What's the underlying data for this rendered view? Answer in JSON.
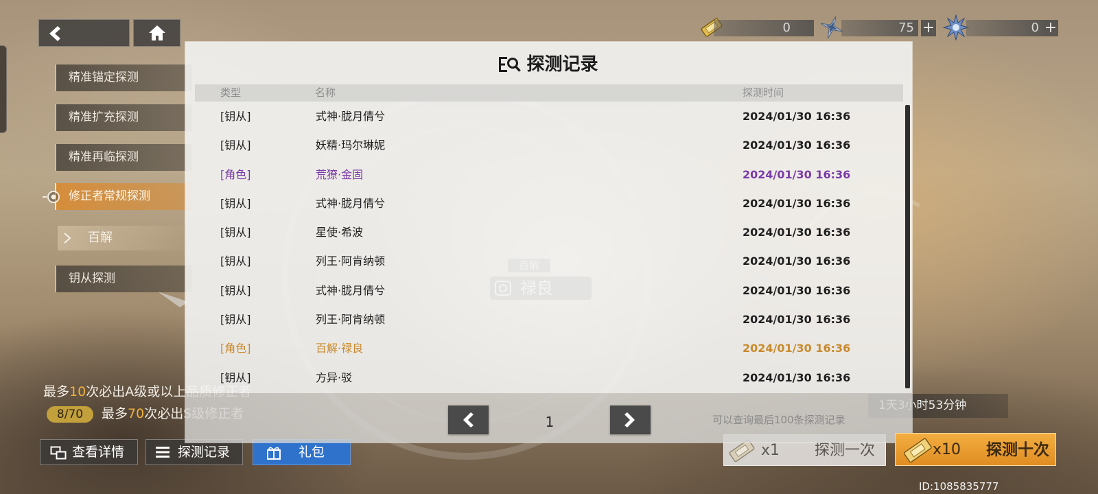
{
  "nav": {
    "back_icon": "arrow-left-icon",
    "home_icon": "home-icon"
  },
  "currencies": [
    {
      "icon": "ticket-icon",
      "value": "0"
    },
    {
      "icon": "star-shard-icon",
      "value": "75",
      "plus_label": "+"
    },
    {
      "icon": "crystal-icon",
      "value": "0",
      "plus_label": "+"
    }
  ],
  "side_menu": {
    "items": [
      {
        "label": "精准锚定探测"
      },
      {
        "label": "精准扩充探测"
      },
      {
        "label": "精准再临探测"
      },
      {
        "label": "修正者常规探测",
        "active": true
      },
      {
        "label": "钥从探测"
      }
    ],
    "sub_item": {
      "label": "百解",
      "icon": "chevron-right-icon",
      "selected": true
    }
  },
  "guarantee": {
    "line1": {
      "prefix": "最多",
      "count": "10",
      "suffix": "次必出A级或以上品质修正者"
    },
    "line2": {
      "progress": "8/70",
      "prefix": "最多",
      "count": "70",
      "suffix": "次必出S级修正者"
    }
  },
  "actions": {
    "details": {
      "label": "查看详情",
      "icon": "windows-icon"
    },
    "records": {
      "label": "探测记录",
      "icon": "list-icon"
    },
    "gift": {
      "label": "礼包",
      "icon": "gift-icon"
    }
  },
  "banner": {
    "tag": "百解",
    "name": "禄良"
  },
  "draw": {
    "timer": "1天3小时53分钟",
    "single": {
      "multiplier": "x1",
      "label": "探测一次",
      "icon": "ticket-icon"
    },
    "ten": {
      "multiplier": "x10",
      "label": "探测十次",
      "icon": "ticket-icon"
    }
  },
  "user_id": "ID:1085835777",
  "modal": {
    "title": "探测记录",
    "title_icon": "list-search-icon",
    "columns": {
      "type": "类型",
      "name": "名称",
      "time": "探测时间"
    },
    "rows": [
      {
        "type": "[钥从]",
        "name": "式神·胧月倩兮",
        "time": "2024/01/30 16:36",
        "tone": "default"
      },
      {
        "type": "[钥从]",
        "name": "妖精·玛尔琳妮",
        "time": "2024/01/30 16:36",
        "tone": "default"
      },
      {
        "type": "[角色]",
        "name": "荒獠·金固",
        "time": "2024/01/30 16:36",
        "tone": "purple"
      },
      {
        "type": "[钥从]",
        "name": "式神·胧月倩兮",
        "time": "2024/01/30 16:36",
        "tone": "default"
      },
      {
        "type": "[钥从]",
        "name": "星使·希波",
        "time": "2024/01/30 16:36",
        "tone": "default"
      },
      {
        "type": "[钥从]",
        "name": "列王·阿肯纳顿",
        "time": "2024/01/30 16:36",
        "tone": "default"
      },
      {
        "type": "[钥从]",
        "name": "式神·胧月倩兮",
        "time": "2024/01/30 16:36",
        "tone": "default"
      },
      {
        "type": "[钥从]",
        "name": "列王·阿肯纳顿",
        "time": "2024/01/30 16:36",
        "tone": "default"
      },
      {
        "type": "[角色]",
        "name": "百解·禄良",
        "time": "2024/01/30 16:36",
        "tone": "gold"
      },
      {
        "type": "[钥从]",
        "name": "方异·驳",
        "time": "2024/01/30 16:36",
        "tone": "default"
      }
    ],
    "pagination": {
      "page": "1",
      "prev_icon": "chevron-left-icon",
      "next_icon": "chevron-right-icon",
      "note": "可以查询最后100条探测记录"
    }
  },
  "colors": {
    "default": "#1f1f1f",
    "purple": "#7a3aa8",
    "gold": "#c98a2c",
    "accent": "#e99a2f",
    "gift_blue": "#2f72cc"
  }
}
